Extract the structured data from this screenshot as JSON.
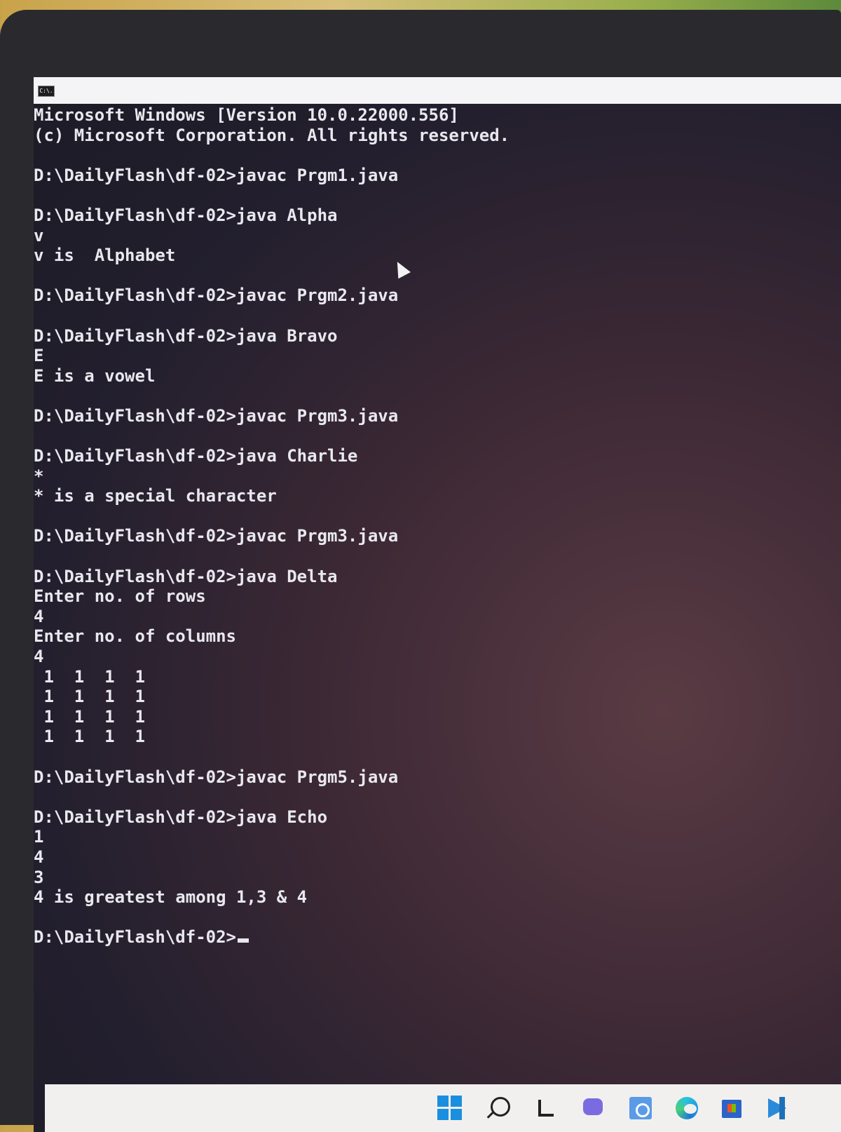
{
  "window": {
    "icon_label": "C:\\."
  },
  "console_lines": [
    "Microsoft Windows [Version 10.0.22000.556]",
    "(c) Microsoft Corporation. All rights reserved.",
    "",
    "D:\\DailyFlash\\df-02>javac Prgm1.java",
    "",
    "D:\\DailyFlash\\df-02>java Alpha",
    "v",
    "v is  Alphabet",
    "",
    "D:\\DailyFlash\\df-02>javac Prgm2.java",
    "",
    "D:\\DailyFlash\\df-02>java Bravo",
    "E",
    "E is a vowel",
    "",
    "D:\\DailyFlash\\df-02>javac Prgm3.java",
    "",
    "D:\\DailyFlash\\df-02>java Charlie",
    "*",
    "* is a special character",
    "",
    "D:\\DailyFlash\\df-02>javac Prgm3.java",
    "",
    "D:\\DailyFlash\\df-02>java Delta",
    "Enter no. of rows",
    "4",
    "Enter no. of columns",
    "4",
    " 1  1  1  1",
    " 1  1  1  1",
    " 1  1  1  1",
    " 1  1  1  1",
    "",
    "D:\\DailyFlash\\df-02>javac Prgm5.java",
    "",
    "D:\\DailyFlash\\df-02>java Echo",
    "1",
    "4",
    "3",
    "4 is greatest among 1,3 & 4",
    ""
  ],
  "prompt": "D:\\DailyFlash\\df-02>",
  "taskbar": {
    "icons": [
      "windows-start-icon",
      "search-icon",
      "task-view-icon",
      "chat-icon",
      "widgets-icon",
      "edge-browser-icon",
      "store-icon",
      "vscode-icon"
    ]
  }
}
